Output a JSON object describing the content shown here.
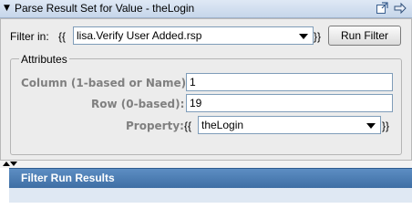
{
  "title_bar": {
    "title": "Parse Result Set for Value - theLogin",
    "icons": [
      "collapse-triangle-icon",
      "dock-window-icon",
      "forward-arrow-icon"
    ]
  },
  "filter": {
    "label": "Filter in:",
    "open_brace": "{{",
    "value": "lisa.Verify User Added.rsp",
    "close_brace": "}}",
    "button_label": "Run Filter"
  },
  "attributes": {
    "title": "Attributes",
    "column_label": "Column (1-based or Name):",
    "column_value": "1",
    "row_label": "Row (0-based):",
    "row_value": "19",
    "property_label": "Property:",
    "open_brace": "{{",
    "property_value": "theLogin",
    "close_brace": "}}"
  },
  "results": {
    "title": "Filter Run Results"
  },
  "colors": {
    "results_header": "#4a7db5",
    "panel_bg": "#ececec",
    "label_gray": "#808080"
  }
}
